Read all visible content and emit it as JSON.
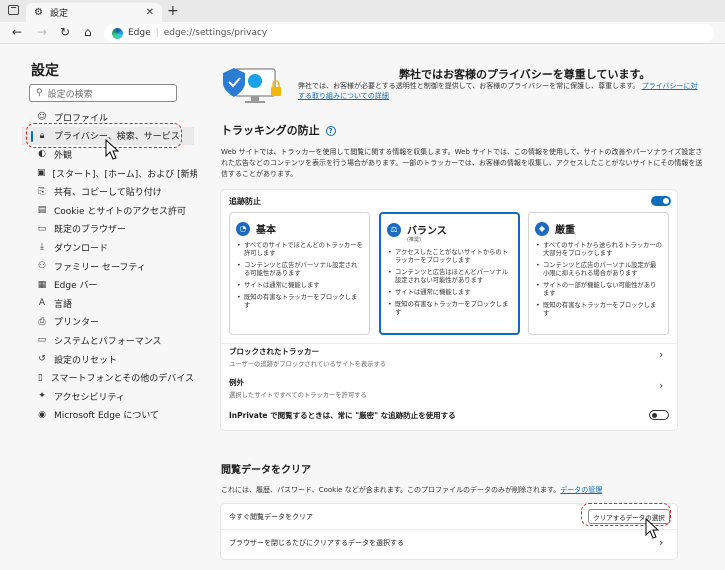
{
  "browser": {
    "tab_title": "設定",
    "close_glyph": "✕",
    "newtab_glyph": "+",
    "url_label": "Edge",
    "url": "edge://settings/privacy"
  },
  "sidebar": {
    "title": "設定",
    "search_placeholder": "設定の検索",
    "items": [
      {
        "label": "プロファイル",
        "icon": "profile-icon",
        "glyph": "☺"
      },
      {
        "label": "プライバシー、検索、サービス",
        "icon": "lock-icon",
        "glyph": "🔒︎",
        "active": true
      },
      {
        "label": "外観",
        "icon": "appearance-icon",
        "glyph": "◐"
      },
      {
        "label": "[スタート]、[ホーム]、および [新規] タブ",
        "icon": "start-icon",
        "glyph": "▣"
      },
      {
        "label": "共有、コピーして貼り付け",
        "icon": "share-icon",
        "glyph": "⎘"
      },
      {
        "label": "Cookie とサイトのアクセス許可",
        "icon": "cookie-icon",
        "glyph": "▤"
      },
      {
        "label": "既定のブラウザー",
        "icon": "browser-icon",
        "glyph": "▭"
      },
      {
        "label": "ダウンロード",
        "icon": "download-icon",
        "glyph": "⤓"
      },
      {
        "label": "ファミリー セーフティ",
        "icon": "family-icon",
        "glyph": "⚇"
      },
      {
        "label": "Edge バー",
        "icon": "edgebar-icon",
        "glyph": "▦"
      },
      {
        "label": "言語",
        "icon": "language-icon",
        "glyph": "A"
      },
      {
        "label": "プリンター",
        "icon": "printer-icon",
        "glyph": "⎙"
      },
      {
        "label": "システムとパフォーマンス",
        "icon": "system-icon",
        "glyph": "▭"
      },
      {
        "label": "設定のリセット",
        "icon": "reset-icon",
        "glyph": "↺"
      },
      {
        "label": "スマートフォンとその他のデバイス",
        "icon": "phone-icon",
        "glyph": "▯"
      },
      {
        "label": "アクセシビリティ",
        "icon": "accessibility-icon",
        "glyph": "✦"
      },
      {
        "label": "Microsoft Edge について",
        "icon": "edge-icon",
        "glyph": "◉"
      }
    ]
  },
  "banner": {
    "title": "弊社ではお客様のプライバシーを尊重しています。",
    "text": "弊社では、お客様が必要とする透明性と制御を提供して、お客様のプライバシーを常に保護し、尊重します。",
    "link": "プライバシーに対する取り組みについての詳細"
  },
  "tracking": {
    "title": "トラッキングの防止",
    "help_glyph": "?",
    "description": "Web サイトでは、トラッカーを使用して閲覧に関する情報を収集します。Web サイトでは、この情報を使用して、サイトの改善やパーソナライズ設定された広告などのコンテンツを表示を行う場合があります。一部のトラッカーでは、お客様の情報を収集し、アクセスしたことがないサイトにその情報を送信することがあります。",
    "prevention_label": "追跡防止",
    "prevention_on": true,
    "options": [
      {
        "title": "基本",
        "subtitle": "",
        "glyph": "◔",
        "bullets": [
          "すべてのサイトでほとんどのトラッカーを許可します",
          "コンテンツと広告がパーソナル設定される可能性があります",
          "サイトは通常に機能します",
          "既知の有害なトラッカーをブロックします"
        ]
      },
      {
        "title": "バランス",
        "subtitle": "(推奨)",
        "glyph": "⚖",
        "bullets": [
          "アクセスしたことがないサイトからのトラッカーをブロックします",
          "コンテンツと広告はほとんどパーソナル設定されない可能性があります",
          "サイトは通常に機能します",
          "既知の有害なトラッカーをブロックします"
        ]
      },
      {
        "title": "厳重",
        "subtitle": "",
        "glyph": "◆",
        "bullets": [
          "すべてのサイトから送られるトラッカーの大部分をブロックします",
          "コンテンツと広告のパーソナル設定が最小限に抑えられる場合があります",
          "サイトの一部が機能しない可能性があります",
          "既知の有害なトラッカーをブロックします"
        ]
      }
    ],
    "blocked_title": "ブロックされたトラッカー",
    "blocked_desc": "ユーザーの追跡がブロックされているサイトを表示する",
    "exceptions_title": "例外",
    "exceptions_desc": "選択したサイトですべてのトラッカーを許可する",
    "inprivate_label": "InPrivate で閲覧するときは、常に \"厳密\" な追跡防止を使用する",
    "inprivate_on": false,
    "chevron_glyph": "›"
  },
  "clear": {
    "title": "閲覧データをクリア",
    "description": "これには、履歴、パスワード、Cookie などが含まれます。このプロファイルのデータのみが削除されます。",
    "link": "データの管理",
    "now_label": "今すぐ閲覧データをクリア",
    "button_label": "クリアするデータの選択",
    "on_close_label": "ブラウザーを閉じるたびにクリアするデータを選択する"
  },
  "colors": {
    "accent": "#0f6cbd",
    "annotation": "#e02020"
  }
}
